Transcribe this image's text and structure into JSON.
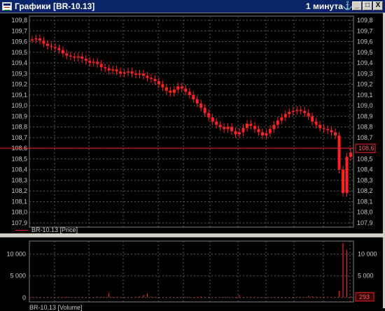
{
  "window": {
    "title": "Графики [BR-10.13]",
    "period": "1 минута",
    "buttons": {
      "minimize": "_",
      "maximize": "□",
      "close": "X"
    }
  },
  "colors": {
    "background": "#000000",
    "grid": "#5a5a5a",
    "axis_text": "#c8c8c8",
    "series": "#ff2020",
    "price_line": "#ff2020"
  },
  "price_pane": {
    "legend": "BR-10.13 [Price]",
    "current_price_label": "108,6",
    "y_ticks": [
      "109,8",
      "109,7",
      "109,6",
      "109,5",
      "109,4",
      "109,3",
      "109,2",
      "109,1",
      "109,0",
      "108,9",
      "108,8",
      "108,7",
      "108,6",
      "108,5",
      "108,4",
      "108,3",
      "108,2",
      "108,1",
      "108,0",
      "107,9"
    ]
  },
  "volume_pane": {
    "legend": "BR-10.13 [Volume]",
    "current_volume_label": "293",
    "y_ticks": [
      "10 000",
      "5 000",
      "0"
    ]
  },
  "chart_data": [
    {
      "type": "candlestick",
      "series_name": "BR-10.13 [Price]",
      "ylim": [
        107.9,
        109.8
      ],
      "horizontal_line": 108.6,
      "values": [
        109.62,
        109.63,
        109.61,
        109.58,
        109.56,
        109.55,
        109.54,
        109.52,
        109.49,
        109.47,
        109.46,
        109.45,
        109.46,
        109.44,
        109.42,
        109.4,
        109.41,
        109.39,
        109.36,
        109.35,
        109.33,
        109.34,
        109.32,
        109.3,
        109.31,
        109.32,
        109.3,
        109.29,
        109.3,
        109.28,
        109.26,
        109.25,
        109.23,
        109.2,
        109.17,
        109.14,
        109.12,
        109.15,
        109.18,
        109.16,
        109.13,
        109.1,
        109.06,
        109.02,
        108.98,
        108.93,
        108.89,
        108.85,
        108.82,
        108.8,
        108.78,
        108.8,
        108.76,
        108.73,
        108.75,
        108.79,
        108.83,
        108.81,
        108.78,
        108.75,
        108.72,
        108.74,
        108.78,
        108.82,
        108.86,
        108.89,
        108.92,
        108.94,
        108.95,
        108.96,
        108.95,
        108.93,
        108.9,
        108.85,
        108.82,
        108.79,
        108.78,
        108.77,
        108.75,
        108.72,
        108.4,
        108.18,
        108.52,
        108.56
      ]
    },
    {
      "type": "bar",
      "series_name": "BR-10.13 [Volume]",
      "ylim": [
        -1000,
        13000
      ],
      "values": [
        200,
        150,
        100,
        120,
        180,
        90,
        110,
        140,
        160,
        200,
        130,
        100,
        120,
        170,
        110,
        90,
        150,
        220,
        180,
        130,
        1100,
        200,
        160,
        140,
        120,
        110,
        150,
        180,
        260,
        600,
        900,
        200,
        160,
        140,
        120,
        100,
        180,
        140,
        130,
        160,
        120,
        150,
        110,
        200,
        240,
        170,
        150,
        130,
        120,
        100,
        150,
        170,
        140,
        130,
        600,
        120,
        140,
        160,
        180,
        150,
        130,
        120,
        110,
        140,
        160,
        150,
        130,
        120,
        150,
        170,
        150,
        120,
        400,
        300,
        200,
        160,
        180,
        200,
        150,
        160,
        1500,
        12500,
        11000,
        293
      ]
    }
  ]
}
